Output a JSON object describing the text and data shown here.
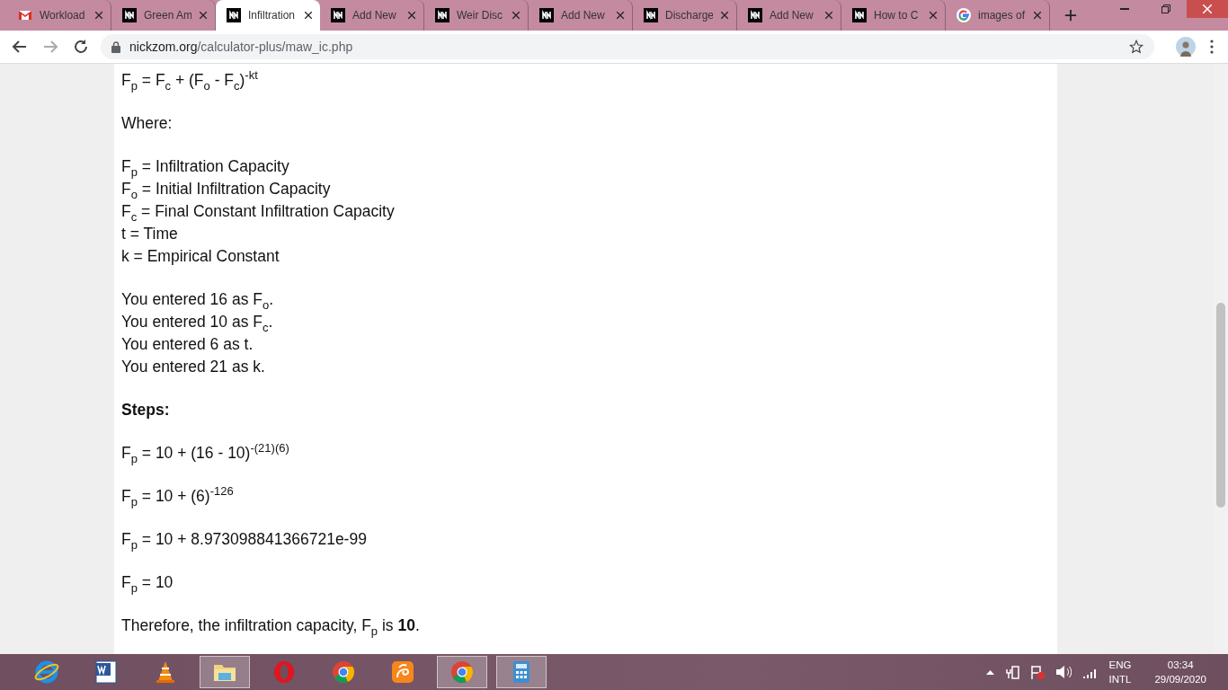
{
  "tabs": [
    {
      "title": "Workload",
      "kind": "mail",
      "selected": false
    },
    {
      "title": "Green Am",
      "kind": "site",
      "selected": false
    },
    {
      "title": "Infiltration",
      "kind": "site",
      "selected": true
    },
    {
      "title": "Add New",
      "kind": "site",
      "selected": false
    },
    {
      "title": "Weir Disc",
      "kind": "site",
      "selected": false
    },
    {
      "title": "Add New",
      "kind": "site",
      "selected": false
    },
    {
      "title": "Discharge",
      "kind": "site",
      "selected": false
    },
    {
      "title": "Add New",
      "kind": "site",
      "selected": false
    },
    {
      "title": "How to C",
      "kind": "site",
      "selected": false
    },
    {
      "title": "images of",
      "kind": "search",
      "selected": false
    }
  ],
  "address": {
    "host": "nickzom.org",
    "path": "/calculator-plus/maw_ic.php"
  },
  "content": [
    {
      "kind": "plain",
      "lines": [
        "F$_{p}$ = F$_{c}$ + (F$_{o}$ - F$_{c}$)$^{-kt}$"
      ]
    },
    {
      "kind": "plain",
      "lines": [
        "Where:"
      ]
    },
    {
      "kind": "plain",
      "lines": [
        "F$_{p}$ = Infiltration Capacity",
        "F$_{o}$ = Initial Infiltration Capacity",
        "F$_{c}$ = Final Constant Infiltration Capacity",
        "t = Time",
        "k = Empirical Constant"
      ]
    },
    {
      "kind": "plain",
      "lines": [
        "You entered 16 as F$_{o}$.",
        "You entered 10 as F$_{c}$.",
        "You entered 6 as t.",
        "You entered 21 as k."
      ]
    },
    {
      "kind": "heading",
      "lines": [
        "Steps:"
      ]
    },
    {
      "kind": "plain",
      "lines": [
        "F$_{p}$ = 10 + (16 - 10)$^{-(21)(6)}$"
      ]
    },
    {
      "kind": "plain",
      "lines": [
        "F$_{p}$ = 10 + (6)$^{-126}$"
      ]
    },
    {
      "kind": "plain",
      "lines": [
        "F$_{p}$ = 10 + 8.973098841366721e-99"
      ]
    },
    {
      "kind": "plain",
      "lines": [
        "F$_{p}$ = 10"
      ]
    },
    {
      "kind": "plain",
      "lines": [
        "Therefore, the infiltration capacity, F$_{p}$ is **10**."
      ]
    }
  ],
  "taskbar": {
    "apps": [
      {
        "kind": "ie",
        "running": false
      },
      {
        "kind": "word",
        "running": false
      },
      {
        "kind": "vlc",
        "running": false
      },
      {
        "kind": "explorer",
        "running": true
      },
      {
        "kind": "opera",
        "running": false
      },
      {
        "kind": "chrome",
        "running": false
      },
      {
        "kind": "uc",
        "running": false
      },
      {
        "kind": "chrome",
        "running": true
      },
      {
        "kind": "calculator",
        "running": true
      }
    ],
    "language": "ENG",
    "layout": "INTL",
    "time": "03:34",
    "date": "29/09/2020"
  }
}
